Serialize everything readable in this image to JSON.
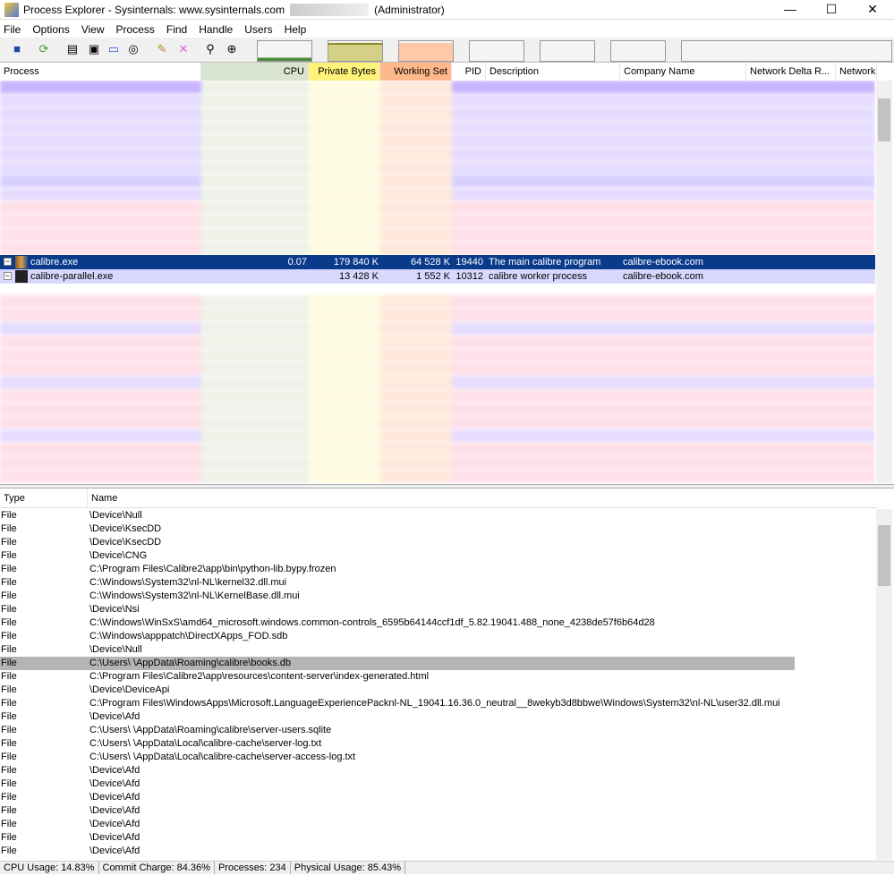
{
  "window": {
    "title": "Process Explorer - Sysinternals: www.sysinternals.com",
    "title_suffix": "(Administrator)"
  },
  "menu": [
    "File",
    "Options",
    "View",
    "Process",
    "Find",
    "Handle",
    "Users",
    "Help"
  ],
  "toolbar": {
    "icons": [
      "save-icon",
      "refresh-icon",
      "system-info-icon",
      "properties-icon",
      "window-icon",
      "dll-icon",
      "options-icon",
      "kill-process-icon",
      "find-icon",
      "target-icon"
    ]
  },
  "process_columns": [
    "Process",
    "CPU",
    "Private Bytes",
    "Working Set",
    "PID",
    "Description",
    "Company Name",
    "Network Delta R...",
    "Network"
  ],
  "colors": {
    "cpu": "#d9e4cf",
    "private": "#fff27a",
    "working": "#ffb88a",
    "selected": "#0a3a8a",
    "purple": "#c8b4ff",
    "pink": "#ffdce6"
  },
  "processes": [
    {
      "name": "calibre.exe",
      "cpu": "0.07",
      "private": "179 840 K",
      "working": "64 528 K",
      "pid": "19440",
      "desc": "The main calibre program",
      "company": "calibre-ebook.com"
    },
    {
      "name": "calibre-parallel.exe",
      "cpu": "",
      "private": "13 428 K",
      "working": "1 552 K",
      "pid": "10312",
      "desc": "calibre worker process",
      "company": "calibre-ebook.com"
    }
  ],
  "handle_columns": [
    "Type",
    "Name"
  ],
  "handles": [
    {
      "type": "File",
      "name": "\\Device\\Null"
    },
    {
      "type": "File",
      "name": "\\Device\\KsecDD"
    },
    {
      "type": "File",
      "name": "\\Device\\KsecDD"
    },
    {
      "type": "File",
      "name": "\\Device\\CNG"
    },
    {
      "type": "File",
      "name": "C:\\Program Files\\Calibre2\\app\\bin\\python-lib.bypy.frozen"
    },
    {
      "type": "File",
      "name": "C:\\Windows\\System32\\nl-NL\\kernel32.dll.mui"
    },
    {
      "type": "File",
      "name": "C:\\Windows\\System32\\nl-NL\\KernelBase.dll.mui"
    },
    {
      "type": "File",
      "name": "\\Device\\Nsi"
    },
    {
      "type": "File",
      "name": "C:\\Windows\\WinSxS\\amd64_microsoft.windows.common-controls_6595b64144ccf1df_5.82.19041.488_none_4238de57f6b64d28"
    },
    {
      "type": "File",
      "name": "C:\\Windows\\apppatch\\DirectXApps_FOD.sdb"
    },
    {
      "type": "File",
      "name": "\\Device\\Null"
    },
    {
      "type": "File",
      "name": "C:\\Users\\          \\AppData\\Roaming\\calibre\\books.db"
    },
    {
      "type": "File",
      "name": "C:\\Program Files\\Calibre2\\app\\resources\\content-server\\index-generated.html"
    },
    {
      "type": "File",
      "name": "\\Device\\DeviceApi"
    },
    {
      "type": "File",
      "name": "C:\\Program Files\\WindowsApps\\Microsoft.LanguageExperiencePacknl-NL_19041.16.36.0_neutral__8wekyb3d8bbwe\\Windows\\System32\\nl-NL\\user32.dll.mui"
    },
    {
      "type": "File",
      "name": "\\Device\\Afd"
    },
    {
      "type": "File",
      "name": "C:\\Users\\          \\AppData\\Roaming\\calibre\\server-users.sqlite"
    },
    {
      "type": "File",
      "name": "C:\\Users\\          \\AppData\\Local\\calibre-cache\\server-log.txt"
    },
    {
      "type": "File",
      "name": "C:\\Users\\          \\AppData\\Local\\calibre-cache\\server-access-log.txt"
    },
    {
      "type": "File",
      "name": "\\Device\\Afd"
    },
    {
      "type": "File",
      "name": "\\Device\\Afd"
    },
    {
      "type": "File",
      "name": "\\Device\\Afd"
    },
    {
      "type": "File",
      "name": "\\Device\\Afd"
    },
    {
      "type": "File",
      "name": "\\Device\\Afd"
    },
    {
      "type": "File",
      "name": "\\Device\\Afd"
    },
    {
      "type": "File",
      "name": "\\Device\\Afd"
    }
  ],
  "highlighted_handle": 11,
  "status": [
    "CPU Usage: 14.83%",
    "Commit Charge: 84.36%",
    "Processes: 234",
    "Physical Usage: 85.43%"
  ]
}
